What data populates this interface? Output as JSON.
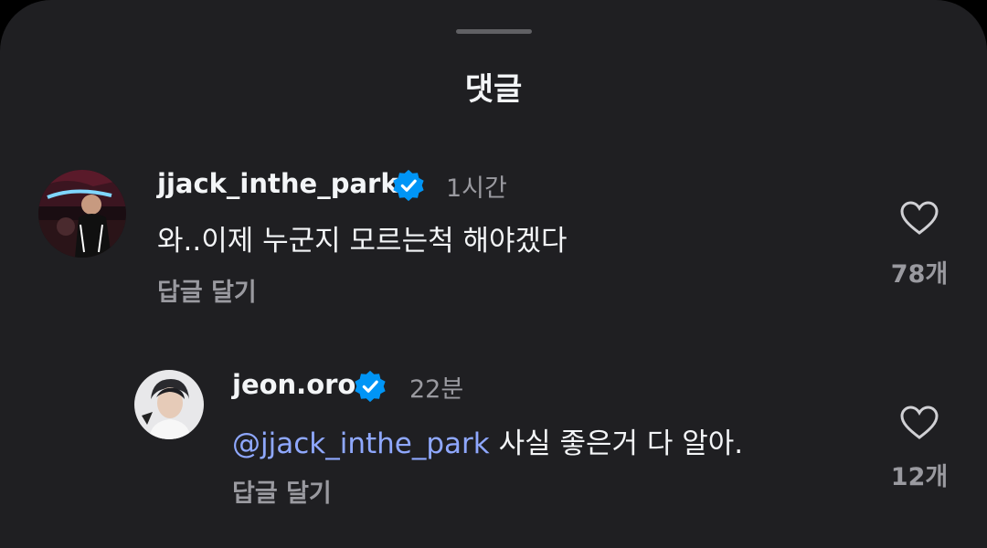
{
  "sheet": {
    "title": "댓글"
  },
  "comments": [
    {
      "username": "jjack_inthe_park",
      "verified": true,
      "time": "1시간",
      "text": "와..이제 누군지 모르는척 해야겠다",
      "reply_label": "답글 달기",
      "likes": "78개",
      "avatar": "avatar-photo-car"
    },
    {
      "username": "jeon.oro",
      "verified": true,
      "time": "22분",
      "mention": "@jjack_inthe_park",
      "text": " 사실 좋은거 다 알아.",
      "reply_label": "답글 달기",
      "likes": "12개",
      "avatar": "avatar-photo-portrait"
    }
  ],
  "colors": {
    "background": "#1f1f22",
    "text": "#f3f5f7",
    "secondary": "#9a9aa0",
    "mention": "#8fa8ff",
    "verified": "#0095f6"
  }
}
